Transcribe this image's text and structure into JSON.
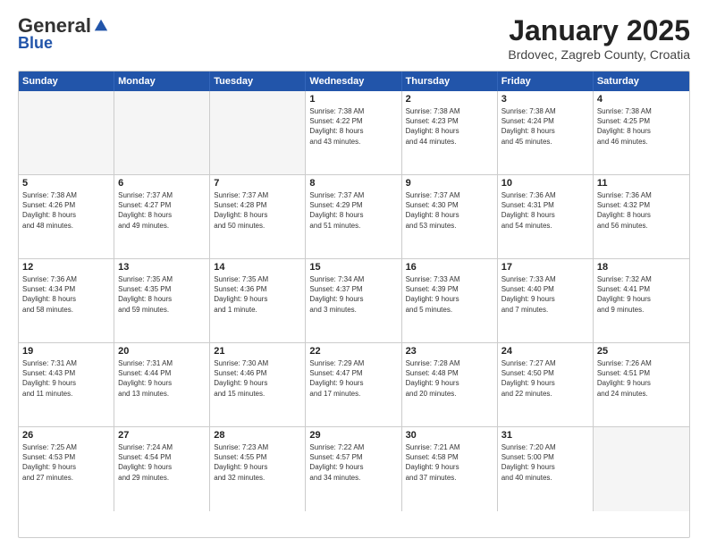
{
  "logo": {
    "general": "General",
    "blue": "Blue"
  },
  "title": "January 2025",
  "location": "Brdovec, Zagreb County, Croatia",
  "header_days": [
    "Sunday",
    "Monday",
    "Tuesday",
    "Wednesday",
    "Thursday",
    "Friday",
    "Saturday"
  ],
  "rows": [
    [
      {
        "day": "",
        "info": "",
        "empty": true
      },
      {
        "day": "",
        "info": "",
        "empty": true
      },
      {
        "day": "",
        "info": "",
        "empty": true
      },
      {
        "day": "1",
        "info": "Sunrise: 7:38 AM\nSunset: 4:22 PM\nDaylight: 8 hours\nand 43 minutes.",
        "empty": false
      },
      {
        "day": "2",
        "info": "Sunrise: 7:38 AM\nSunset: 4:23 PM\nDaylight: 8 hours\nand 44 minutes.",
        "empty": false
      },
      {
        "day": "3",
        "info": "Sunrise: 7:38 AM\nSunset: 4:24 PM\nDaylight: 8 hours\nand 45 minutes.",
        "empty": false
      },
      {
        "day": "4",
        "info": "Sunrise: 7:38 AM\nSunset: 4:25 PM\nDaylight: 8 hours\nand 46 minutes.",
        "empty": false
      }
    ],
    [
      {
        "day": "5",
        "info": "Sunrise: 7:38 AM\nSunset: 4:26 PM\nDaylight: 8 hours\nand 48 minutes.",
        "empty": false
      },
      {
        "day": "6",
        "info": "Sunrise: 7:37 AM\nSunset: 4:27 PM\nDaylight: 8 hours\nand 49 minutes.",
        "empty": false
      },
      {
        "day": "7",
        "info": "Sunrise: 7:37 AM\nSunset: 4:28 PM\nDaylight: 8 hours\nand 50 minutes.",
        "empty": false
      },
      {
        "day": "8",
        "info": "Sunrise: 7:37 AM\nSunset: 4:29 PM\nDaylight: 8 hours\nand 51 minutes.",
        "empty": false
      },
      {
        "day": "9",
        "info": "Sunrise: 7:37 AM\nSunset: 4:30 PM\nDaylight: 8 hours\nand 53 minutes.",
        "empty": false
      },
      {
        "day": "10",
        "info": "Sunrise: 7:36 AM\nSunset: 4:31 PM\nDaylight: 8 hours\nand 54 minutes.",
        "empty": false
      },
      {
        "day": "11",
        "info": "Sunrise: 7:36 AM\nSunset: 4:32 PM\nDaylight: 8 hours\nand 56 minutes.",
        "empty": false
      }
    ],
    [
      {
        "day": "12",
        "info": "Sunrise: 7:36 AM\nSunset: 4:34 PM\nDaylight: 8 hours\nand 58 minutes.",
        "empty": false
      },
      {
        "day": "13",
        "info": "Sunrise: 7:35 AM\nSunset: 4:35 PM\nDaylight: 8 hours\nand 59 minutes.",
        "empty": false
      },
      {
        "day": "14",
        "info": "Sunrise: 7:35 AM\nSunset: 4:36 PM\nDaylight: 9 hours\nand 1 minute.",
        "empty": false
      },
      {
        "day": "15",
        "info": "Sunrise: 7:34 AM\nSunset: 4:37 PM\nDaylight: 9 hours\nand 3 minutes.",
        "empty": false
      },
      {
        "day": "16",
        "info": "Sunrise: 7:33 AM\nSunset: 4:39 PM\nDaylight: 9 hours\nand 5 minutes.",
        "empty": false
      },
      {
        "day": "17",
        "info": "Sunrise: 7:33 AM\nSunset: 4:40 PM\nDaylight: 9 hours\nand 7 minutes.",
        "empty": false
      },
      {
        "day": "18",
        "info": "Sunrise: 7:32 AM\nSunset: 4:41 PM\nDaylight: 9 hours\nand 9 minutes.",
        "empty": false
      }
    ],
    [
      {
        "day": "19",
        "info": "Sunrise: 7:31 AM\nSunset: 4:43 PM\nDaylight: 9 hours\nand 11 minutes.",
        "empty": false
      },
      {
        "day": "20",
        "info": "Sunrise: 7:31 AM\nSunset: 4:44 PM\nDaylight: 9 hours\nand 13 minutes.",
        "empty": false
      },
      {
        "day": "21",
        "info": "Sunrise: 7:30 AM\nSunset: 4:46 PM\nDaylight: 9 hours\nand 15 minutes.",
        "empty": false
      },
      {
        "day": "22",
        "info": "Sunrise: 7:29 AM\nSunset: 4:47 PM\nDaylight: 9 hours\nand 17 minutes.",
        "empty": false
      },
      {
        "day": "23",
        "info": "Sunrise: 7:28 AM\nSunset: 4:48 PM\nDaylight: 9 hours\nand 20 minutes.",
        "empty": false
      },
      {
        "day": "24",
        "info": "Sunrise: 7:27 AM\nSunset: 4:50 PM\nDaylight: 9 hours\nand 22 minutes.",
        "empty": false
      },
      {
        "day": "25",
        "info": "Sunrise: 7:26 AM\nSunset: 4:51 PM\nDaylight: 9 hours\nand 24 minutes.",
        "empty": false
      }
    ],
    [
      {
        "day": "26",
        "info": "Sunrise: 7:25 AM\nSunset: 4:53 PM\nDaylight: 9 hours\nand 27 minutes.",
        "empty": false
      },
      {
        "day": "27",
        "info": "Sunrise: 7:24 AM\nSunset: 4:54 PM\nDaylight: 9 hours\nand 29 minutes.",
        "empty": false
      },
      {
        "day": "28",
        "info": "Sunrise: 7:23 AM\nSunset: 4:55 PM\nDaylight: 9 hours\nand 32 minutes.",
        "empty": false
      },
      {
        "day": "29",
        "info": "Sunrise: 7:22 AM\nSunset: 4:57 PM\nDaylight: 9 hours\nand 34 minutes.",
        "empty": false
      },
      {
        "day": "30",
        "info": "Sunrise: 7:21 AM\nSunset: 4:58 PM\nDaylight: 9 hours\nand 37 minutes.",
        "empty": false
      },
      {
        "day": "31",
        "info": "Sunrise: 7:20 AM\nSunset: 5:00 PM\nDaylight: 9 hours\nand 40 minutes.",
        "empty": false
      },
      {
        "day": "",
        "info": "",
        "empty": true
      }
    ]
  ]
}
